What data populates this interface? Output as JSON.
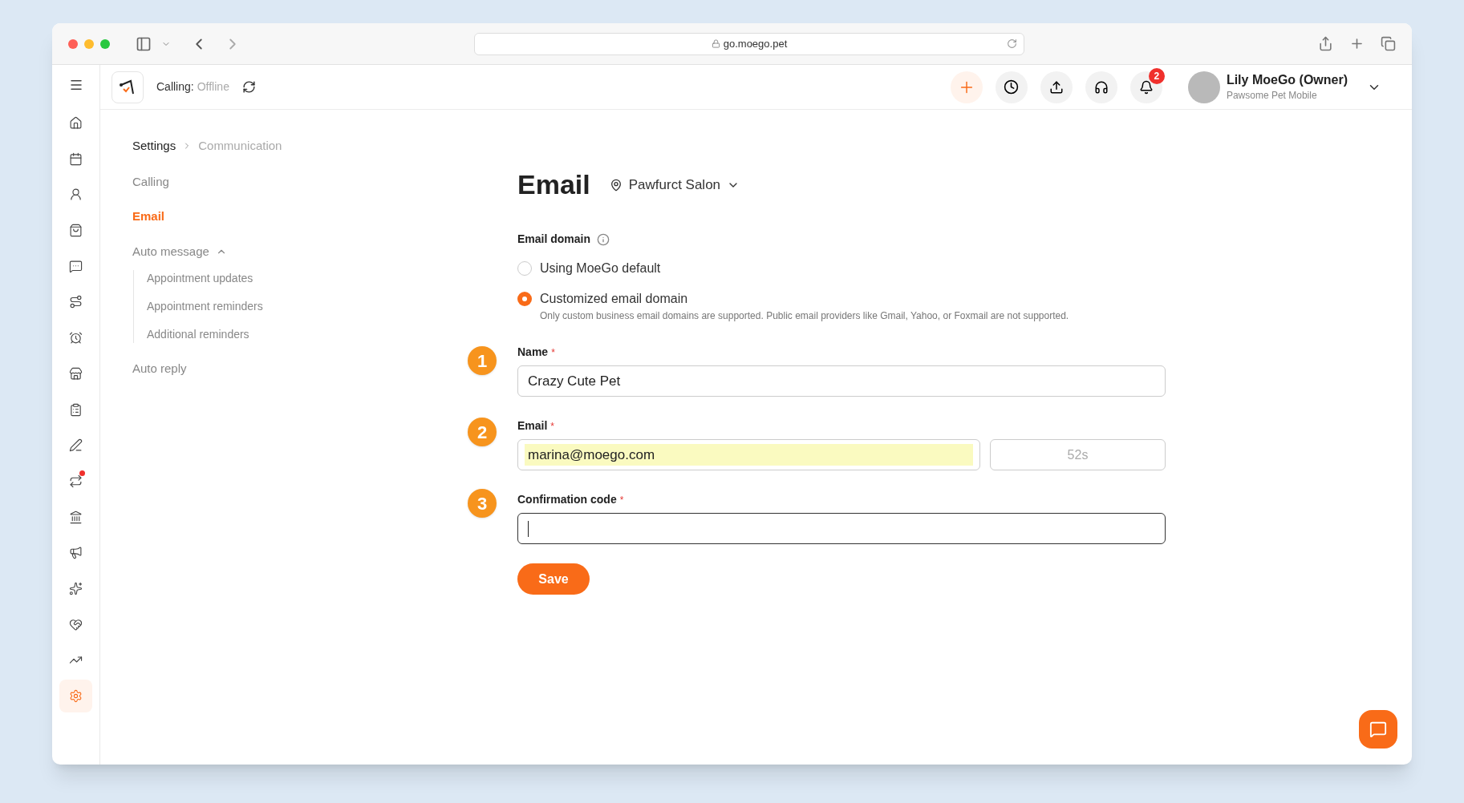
{
  "browser": {
    "url": "go.moego.pet"
  },
  "header": {
    "calling_label": "Calling:",
    "calling_status": "Offline",
    "notification_count": "2",
    "user_name": "Lily MoeGo (Owner)",
    "business_name": "Pawsome Pet Mobile"
  },
  "sidebar": {
    "items": [
      {
        "selected": false,
        "alert": false
      },
      {
        "selected": false,
        "alert": false
      },
      {
        "selected": false,
        "alert": false
      },
      {
        "selected": false,
        "alert": false
      },
      {
        "selected": false,
        "alert": false
      },
      {
        "selected": false,
        "alert": false
      },
      {
        "selected": false,
        "alert": false
      },
      {
        "selected": false,
        "alert": false
      },
      {
        "selected": false,
        "alert": false
      },
      {
        "selected": false,
        "alert": false
      },
      {
        "selected": false,
        "alert": true
      },
      {
        "selected": false,
        "alert": false
      },
      {
        "selected": false,
        "alert": false
      },
      {
        "selected": false,
        "alert": false
      },
      {
        "selected": false,
        "alert": false
      },
      {
        "selected": false,
        "alert": false
      },
      {
        "selected": true,
        "alert": false
      }
    ]
  },
  "breadcrumb": [
    "Settings",
    "Communication"
  ],
  "settings_nav": [
    {
      "label": "Calling",
      "selected": false
    },
    {
      "label": "Email",
      "selected": true
    },
    {
      "label": "Auto message",
      "selected": false,
      "expanded": true,
      "children": [
        {
          "label": "Appointment updates",
          "selected": false
        },
        {
          "label": "Appointment reminders",
          "selected": false
        },
        {
          "label": "Additional reminders",
          "selected": false
        }
      ]
    },
    {
      "label": "Auto reply",
      "selected": false
    }
  ],
  "page": {
    "title": "Email",
    "location": "Pawfurct Salon"
  },
  "email_domain": {
    "label": "Email domain",
    "options": [
      {
        "label": "Using MoeGo default",
        "selected": false
      },
      {
        "label": "Customized email domain",
        "selected": true,
        "note": "Only custom business email domains are supported. Public email providers like Gmail, Yahoo, or Foxmail are not supported."
      }
    ]
  },
  "fields": [
    {
      "step": "1",
      "label": "Name",
      "required_mark": "*",
      "value": "Crazy Cute Pet",
      "focused": false
    },
    {
      "step": "2",
      "label": "Email",
      "required_mark": "*",
      "value": "marina@moego.com",
      "countdown": "52s",
      "focused": false
    },
    {
      "step": "3",
      "label": "Confirmation code",
      "required_mark": "*",
      "focused": true
    }
  ],
  "save_button": "Save"
}
